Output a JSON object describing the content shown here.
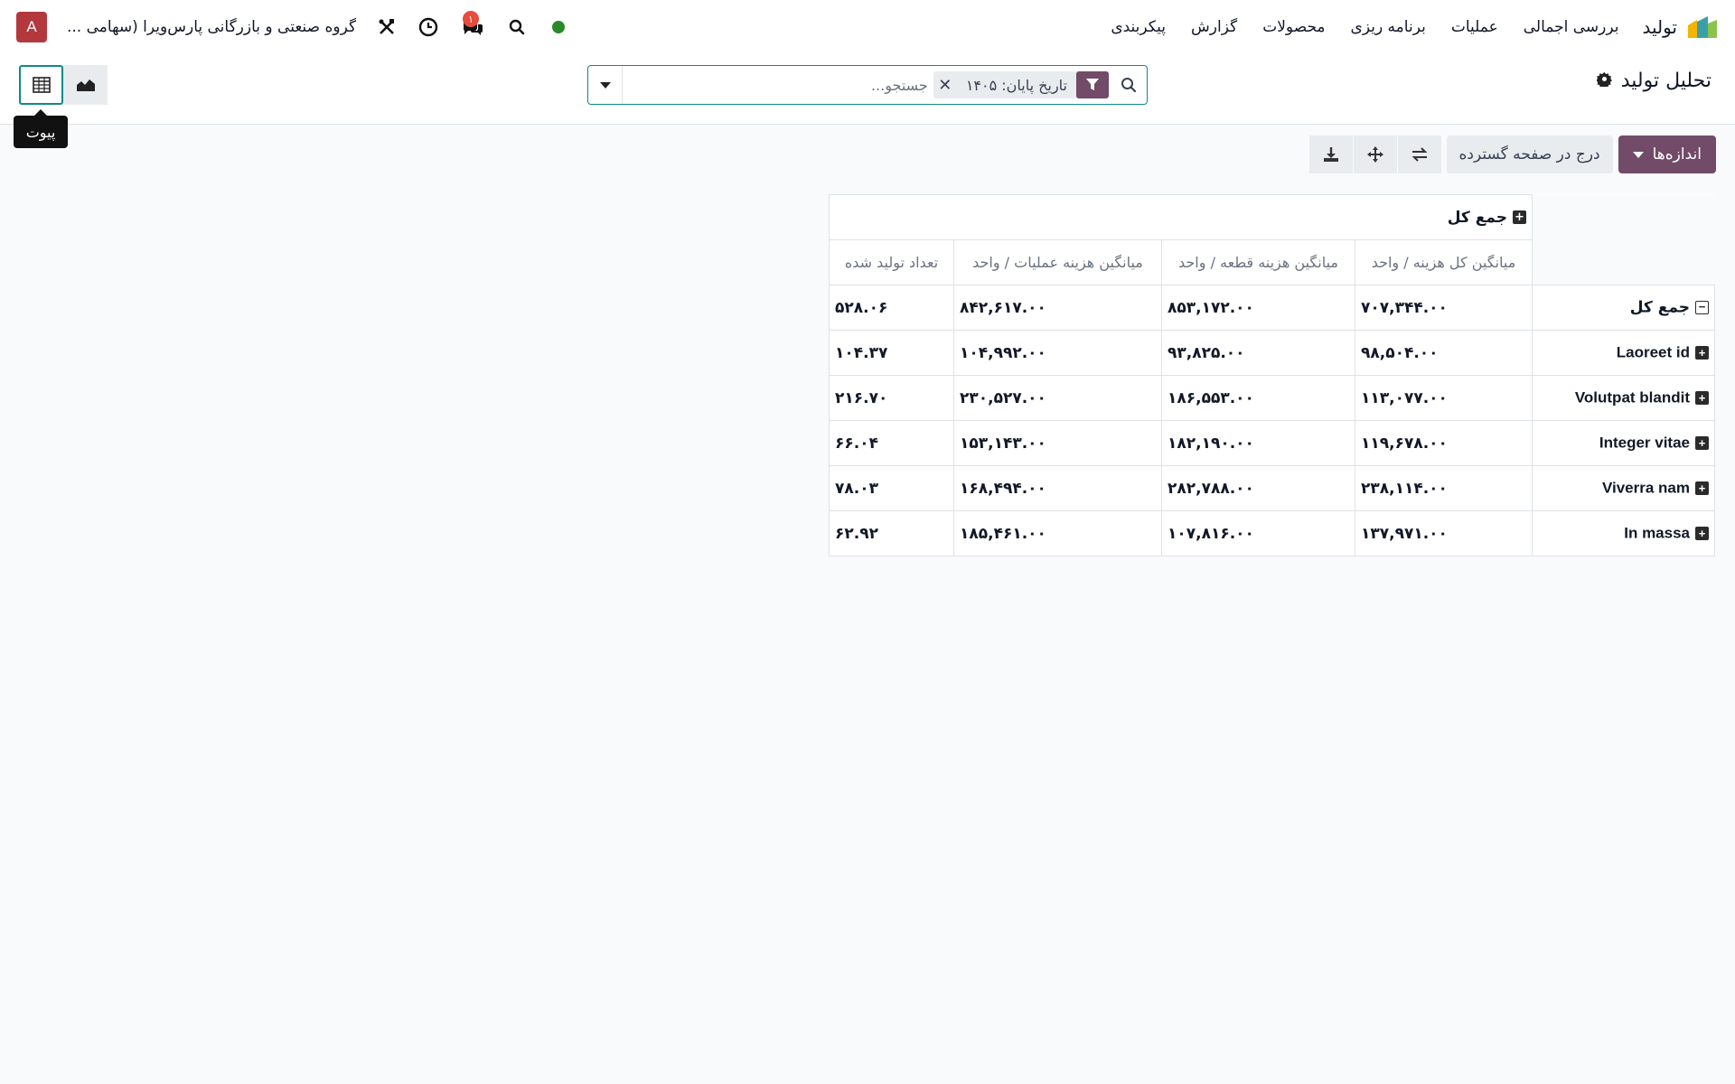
{
  "navbar": {
    "app_name": "تولید",
    "menu": [
      "بررسی اجمالی",
      "عملیات",
      "برنامه ریزی",
      "محصولات",
      "گزارش",
      "پیکربندی"
    ],
    "company": "گروه صنعتی و بازرگانی پارس‌ویرا (سهامی ...",
    "avatar": "A",
    "chat_badge": "۱"
  },
  "control": {
    "title": "تحلیل تولید",
    "facet_value": "تاریخ پایان: ۱۴۰۵",
    "search_placeholder": "جستجو...",
    "tooltip": "پیوت"
  },
  "toolbar": {
    "measures": "اندازه‌ها",
    "insert_spreadsheet": "درج در صفحه گسترده"
  },
  "pivot": {
    "col_total": "جمع کل",
    "measures": [
      "میانگین کل هزینه / واحد",
      "میانگین هزینه قطعه / واحد",
      "میانگین هزینه عملیات / واحد",
      "تعداد تولید شده"
    ],
    "total_row": {
      "label": "جمع کل",
      "values": [
        "۷۰۷,۳۴۴.۰۰",
        "۸۵۳,۱۷۲.۰۰",
        "۸۴۲,۶۱۷.۰۰",
        "۵۲۸.۰۶"
      ]
    },
    "rows": [
      {
        "label": "Laoreet id",
        "values": [
          "۹۸,۵۰۴.۰۰",
          "۹۳,۸۲۵.۰۰",
          "۱۰۴,۹۹۲.۰۰",
          "۱۰۴.۳۷"
        ]
      },
      {
        "label": "Volutpat blandit",
        "values": [
          "۱۱۳,۰۷۷.۰۰",
          "۱۸۶,۵۵۳.۰۰",
          "۲۳۰,۵۲۷.۰۰",
          "۲۱۶.۷۰"
        ]
      },
      {
        "label": "Integer vitae",
        "values": [
          "۱۱۹,۶۷۸.۰۰",
          "۱۸۲,۱۹۰.۰۰",
          "۱۵۳,۱۴۳.۰۰",
          "۶۶.۰۴"
        ]
      },
      {
        "label": "Viverra nam",
        "values": [
          "۲۳۸,۱۱۴.۰۰",
          "۲۸۲,۷۸۸.۰۰",
          "۱۶۸,۴۹۴.۰۰",
          "۷۸.۰۳"
        ]
      },
      {
        "label": "In massa",
        "values": [
          "۱۳۷,۹۷۱.۰۰",
          "۱۰۷,۸۱۶.۰۰",
          "۱۸۵,۴۶۱.۰۰",
          "۶۲.۹۲"
        ]
      }
    ]
  },
  "colors": {
    "primary": "#714b67",
    "accent": "#0d8a8a",
    "status": "#2a8a2a",
    "badge": "#e74c3c",
    "avatar": "#b3383e"
  }
}
